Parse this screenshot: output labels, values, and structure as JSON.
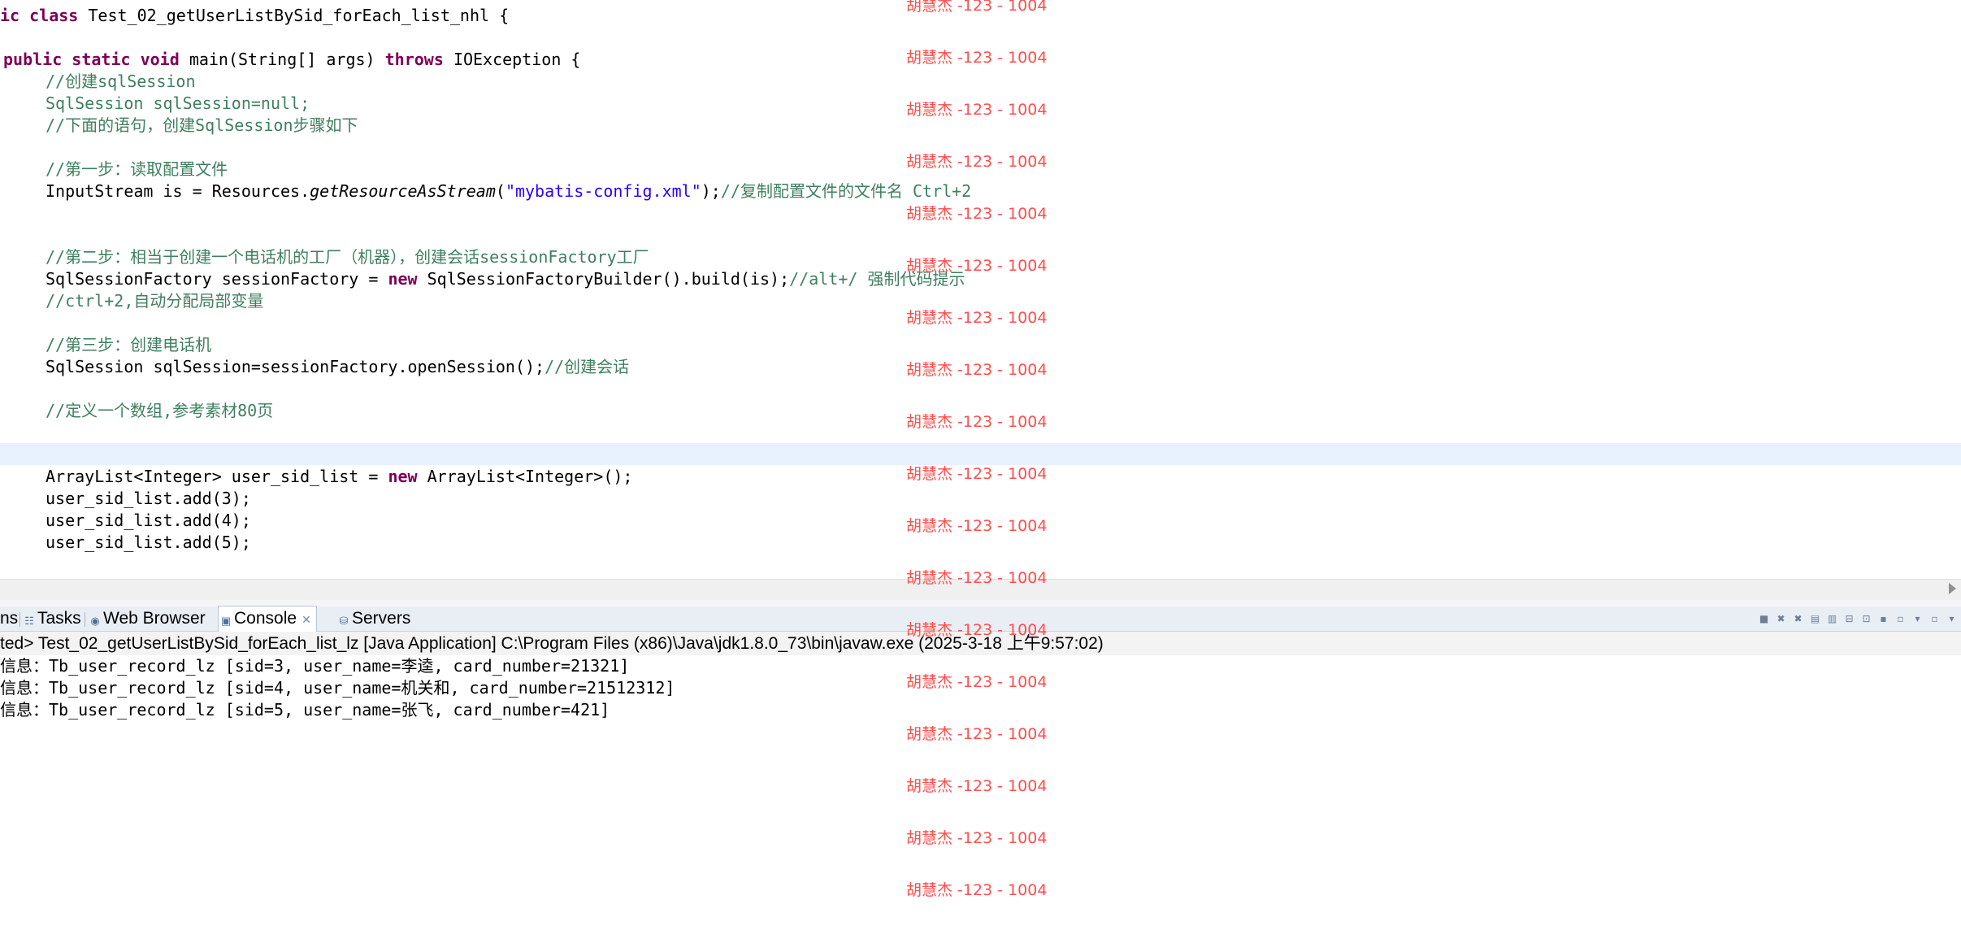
{
  "editor": {
    "lines": [
      {
        "parts": [
          {
            "t": "ic ",
            "c": "kw"
          },
          {
            "t": "class ",
            "c": "kw"
          },
          {
            "t": "Test_02_getUserListBySid_forEach_list_nhl {",
            "c": ""
          }
        ]
      },
      {
        "parts": [
          {
            "t": "public ",
            "c": "kw"
          },
          {
            "t": "static ",
            "c": "kw"
          },
          {
            "t": "void ",
            "c": "kw"
          },
          {
            "t": "main(String[] args) ",
            "c": ""
          },
          {
            "t": "throws ",
            "c": "kw"
          },
          {
            "t": "IOException {",
            "c": ""
          }
        ]
      },
      {
        "parts": [
          {
            "t": "//创建sqlSession",
            "c": "cm"
          }
        ]
      },
      {
        "parts": [
          {
            "t": "SqlSession sqlSession=null;",
            "c": "cm"
          }
        ]
      },
      {
        "parts": [
          {
            "t": "//下面的语句，创建SqlSession步骤如下",
            "c": "cm"
          }
        ]
      },
      {
        "parts": [
          {
            "t": "//第一步：读取配置文件",
            "c": "cm"
          }
        ]
      },
      {
        "parts": [
          {
            "t": "InputStream is = Resources.",
            "c": ""
          },
          {
            "t": "getResourceAsStream",
            "c": "it"
          },
          {
            "t": "(",
            "c": ""
          },
          {
            "t": "\"mybatis-config.xml\"",
            "c": "str"
          },
          {
            "t": ");",
            "c": ""
          },
          {
            "t": "//复制配置文件的文件名 Ctrl+2",
            "c": "cm"
          }
        ]
      },
      {
        "parts": [
          {
            "t": "//第二步：相当于创建一个电话机的工厂（机器），创建会话sessionFactory工厂",
            "c": "cm"
          }
        ]
      },
      {
        "parts": [
          {
            "t": "SqlSessionFactory sessionFactory = ",
            "c": ""
          },
          {
            "t": "new ",
            "c": "kw"
          },
          {
            "t": "SqlSessionFactoryBuilder().build(is);",
            "c": ""
          },
          {
            "t": "//alt+/ 强制代码提示",
            "c": "cm"
          }
        ]
      },
      {
        "parts": [
          {
            "t": "//ctrl+2,自动分配局部变量",
            "c": "cm"
          }
        ]
      },
      {
        "parts": [
          {
            "t": "//第三步：创建电话机",
            "c": "cm"
          }
        ]
      },
      {
        "parts": [
          {
            "t": "SqlSession sqlSession=sessionFactory.openSession();",
            "c": ""
          },
          {
            "t": "//创建会话",
            "c": "cm"
          }
        ]
      },
      {
        "parts": [
          {
            "t": "//定义一个数组,参考素材80页",
            "c": "cm"
          }
        ]
      },
      {
        "parts": [
          {
            "t": "ArrayList<Integer> user_sid_list = ",
            "c": ""
          },
          {
            "t": "new ",
            "c": "kw"
          },
          {
            "t": "ArrayList<Integer>();",
            "c": ""
          }
        ]
      },
      {
        "parts": [
          {
            "t": "user_sid_list.add(3);",
            "c": ""
          }
        ]
      },
      {
        "parts": [
          {
            "t": "user_sid_list.add(4);",
            "c": ""
          }
        ]
      },
      {
        "parts": [
          {
            "t": "user_sid_list.add(5);",
            "c": ""
          }
        ]
      }
    ]
  },
  "views": {
    "tabs": [
      {
        "label": "ns",
        "icon": "problems-icon"
      },
      {
        "label": "Tasks",
        "icon": "tasks-icon"
      },
      {
        "label": "Web Browser",
        "icon": "globe-icon"
      },
      {
        "label": "Console",
        "icon": "console-icon",
        "active": true,
        "close": "✕"
      },
      {
        "label": "Servers",
        "icon": "servers-icon"
      }
    ]
  },
  "console": {
    "header": "ted> Test_02_getUserListBySid_forEach_list_lz [Java Application] C:\\Program Files (x86)\\Java\\jdk1.8.0_73\\bin\\javaw.exe (2025-3-18 上午9:57:02)",
    "lines": [
      "信息：Tb_user_record_lz [sid=3, user_name=李逵, card_number=21321]",
      "信息：Tb_user_record_lz [sid=4, user_name=机关和, card_number=21512312]",
      "信息：Tb_user_record_lz [sid=5, user_name=张飞, card_number=421]"
    ]
  },
  "watermark": {
    "text": "胡慧杰 -123 - 1004",
    "count": 18,
    "color": "#ff4d4d"
  },
  "colors": {
    "keyword": "#7f0055",
    "comment": "#3f7f5f",
    "string": "#2a00ff",
    "current_line": "#e8f2fe"
  }
}
